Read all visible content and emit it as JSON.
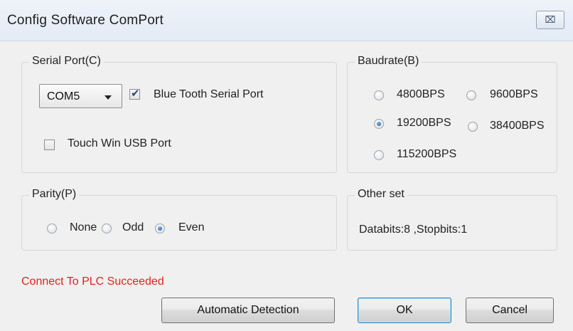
{
  "window": {
    "title": "Config Software ComPort",
    "close_glyph": "⌧"
  },
  "serial_port": {
    "legend": "Serial Port(C)",
    "combo_value": "COM5",
    "bluetooth_label": "Blue Tooth Serial Port",
    "bluetooth_checked": true,
    "usb_label": "Touch Win USB Port",
    "usb_checked": false
  },
  "baudrate": {
    "legend": "Baudrate(B)",
    "options": [
      {
        "label": "4800BPS",
        "checked": false
      },
      {
        "label": "9600BPS",
        "checked": false
      },
      {
        "label": "19200BPS",
        "checked": true
      },
      {
        "label": "38400BPS",
        "checked": false
      },
      {
        "label": "115200BPS",
        "checked": false
      }
    ]
  },
  "parity": {
    "legend": "Parity(P)",
    "options": [
      {
        "label": "None",
        "checked": false
      },
      {
        "label": "Odd",
        "checked": false
      },
      {
        "label": "Even",
        "checked": true
      }
    ]
  },
  "other_set": {
    "legend": "Other set",
    "text": "Databits:8 ,Stopbits:1"
  },
  "status": {
    "text": "Connect To PLC Succeeded",
    "color": "#e8201a"
  },
  "buttons": {
    "auto_detect": "Automatic Detection",
    "ok": "OK",
    "cancel": "Cancel"
  }
}
